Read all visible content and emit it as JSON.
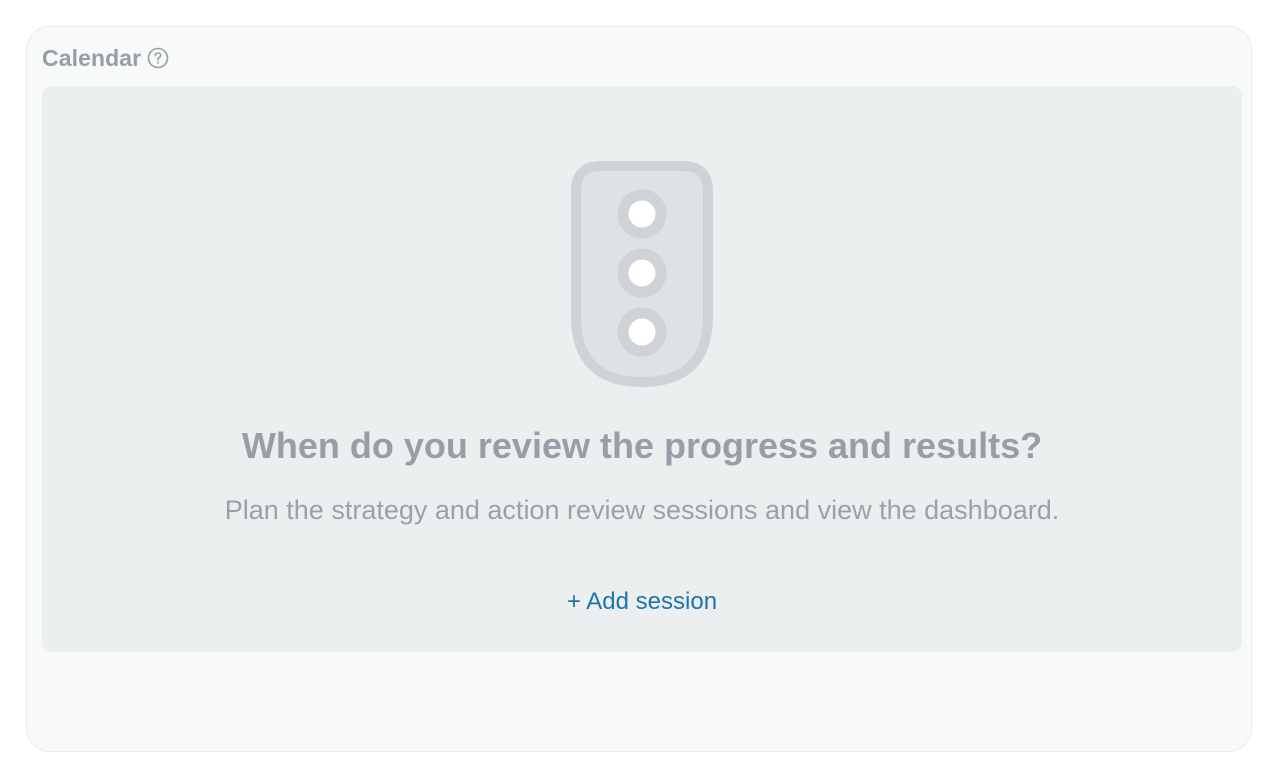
{
  "card": {
    "title": "Calendar",
    "help_icon": "question-circle-icon"
  },
  "empty_state": {
    "illustration_icon": "traffic-light-icon",
    "title": "When do you review the progress and results?",
    "description": "Plan the strategy and action review sessions and view the dashboard.",
    "add_label": "+ Add session"
  },
  "colors": {
    "card_bg": "#f8f9f9",
    "panel_bg": "#eceff0",
    "muted_text": "#969fa5",
    "link": "#1f74ad",
    "illustration_stroke": "#cfd3d7",
    "illustration_fill": "#dfe2e5"
  }
}
